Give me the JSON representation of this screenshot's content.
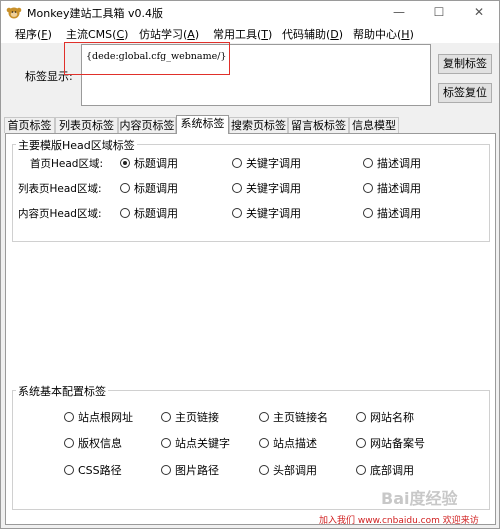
{
  "window": {
    "title": "Monkey建站工具箱 v0.4版",
    "minimize": "—",
    "maximize": "☐",
    "close": "✕"
  },
  "menu": [
    {
      "label": "程序(",
      "key": "F",
      "suffix": ")"
    },
    {
      "label": "主流CMS(",
      "key": "C",
      "suffix": ")"
    },
    {
      "label": "仿站学习(",
      "key": "A",
      "suffix": ")"
    },
    {
      "label": "常用工具(",
      "key": "T",
      "suffix": ")"
    },
    {
      "label": "代码辅助(",
      "key": "D",
      "suffix": ")"
    },
    {
      "label": "帮助中心(",
      "key": "H",
      "suffix": ")"
    }
  ],
  "tag_display": {
    "label": "标签显示:",
    "value": "{dede:global.cfg_webname/}"
  },
  "buttons": {
    "copy": "复制标签",
    "reset": "标签复位"
  },
  "tabs": [
    "首页标签",
    "列表页标签",
    "内容页标签",
    "系统标签",
    "搜索页标签",
    "留言板标签",
    "信息模型"
  ],
  "active_tab": "系统标签",
  "head_group": {
    "title": "主要模版Head区域标签",
    "rows": [
      {
        "label": "首页Head区域:",
        "options": [
          "标题调用",
          "关键字调用",
          "描述调用"
        ],
        "selected": 0
      },
      {
        "label": "列表页Head区域:",
        "options": [
          "标题调用",
          "关键字调用",
          "描述调用"
        ],
        "selected": -1
      },
      {
        "label": "内容页Head区域:",
        "options": [
          "标题调用",
          "关键字调用",
          "描述调用"
        ],
        "selected": -1
      }
    ]
  },
  "basic_group": {
    "title": "系统基本配置标签",
    "rows": [
      [
        "站点根网址",
        "主页链接",
        "主页链接名",
        "网站名称"
      ],
      [
        "版权信息",
        "站点关键字",
        "站点描述",
        "网站备案号"
      ],
      [
        "CSS路径",
        "图片路径",
        "头部调用",
        "底部调用"
      ]
    ]
  },
  "watermark": "Bai度经验",
  "footer_note": "加入我们 www.cnbaidu.com 欢迎来访"
}
